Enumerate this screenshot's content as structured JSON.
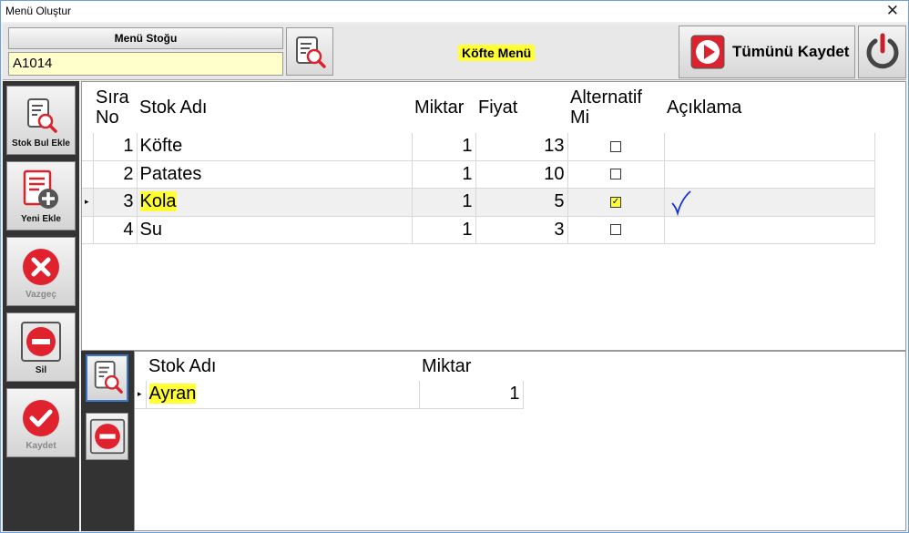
{
  "window": {
    "title": "Menü Oluştur",
    "close": "✕"
  },
  "header": {
    "stock_label": "Menü Stoğu",
    "stock_code": "A1014",
    "menu_name": "Köfte Menü",
    "save_all_label": "Tümünü Kaydet"
  },
  "sidebar": {
    "find_label": "Stok Bul Ekle",
    "new_label": "Yeni Ekle",
    "cancel_label": "Vazgeç",
    "delete_label": "Sil",
    "save_label": "Kaydet"
  },
  "grid": {
    "headers": {
      "no": "Sıra No",
      "name": "Stok Adı",
      "qty": "Miktar",
      "price": "Fiyat",
      "alt": "Alternatif Mi",
      "desc": "Açıklama"
    },
    "rows": [
      {
        "no": "1",
        "name": "Köfte",
        "qty": "1",
        "price": "13",
        "alt": false
      },
      {
        "no": "2",
        "name": "Patates",
        "qty": "1",
        "price": "10",
        "alt": false
      },
      {
        "no": "3",
        "name": "Kola",
        "qty": "1",
        "price": "5",
        "alt": true
      },
      {
        "no": "4",
        "name": "Su",
        "qty": "1",
        "price": "3",
        "alt": false
      }
    ]
  },
  "subgrid": {
    "headers": {
      "name": "Stok Adı",
      "qty": "Miktar"
    },
    "rows": [
      {
        "name": "Ayran",
        "qty": "1"
      }
    ]
  },
  "colors": {
    "highlight": "#ffff33",
    "sidebar": "#333333",
    "red": "#e0212e"
  }
}
